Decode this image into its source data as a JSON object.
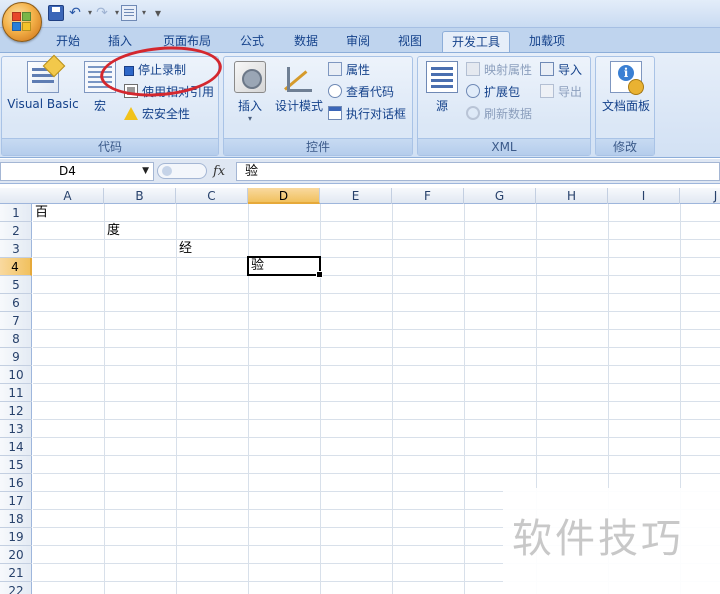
{
  "qat": {
    "save_icon": "save-icon",
    "undo_icon": "undo-icon",
    "redo_icon": "redo-icon",
    "customize": "▾"
  },
  "tabs": [
    {
      "label": "开始"
    },
    {
      "label": "插入"
    },
    {
      "label": "页面布局"
    },
    {
      "label": "公式"
    },
    {
      "label": "数据"
    },
    {
      "label": "审阅"
    },
    {
      "label": "视图"
    },
    {
      "label": "开发工具",
      "active": true
    },
    {
      "label": "加载项"
    }
  ],
  "ribbon": {
    "code": {
      "label": "代码",
      "visual_basic": "Visual Basic",
      "macros": "宏",
      "stop_recording": "停止录制",
      "relative_ref": "使用相对引用",
      "macro_security": "宏安全性"
    },
    "controls": {
      "label": "控件",
      "insert": "插入",
      "design_mode": "设计模式",
      "properties": "属性",
      "view_code": "查看代码",
      "run_dialog": "执行对话框"
    },
    "xml": {
      "label": "XML",
      "source": "源",
      "map_properties": "映射属性",
      "expansion_packs": "扩展包",
      "refresh_data": "刷新数据",
      "import": "导入",
      "export": "导出"
    },
    "modify": {
      "label": "修改",
      "document_panel": "文档面板"
    }
  },
  "formula_bar": {
    "name_box": "D4",
    "fx": "fx",
    "content": "验"
  },
  "columns": [
    "A",
    "B",
    "C",
    "D",
    "E",
    "F",
    "G",
    "H",
    "I",
    "J"
  ],
  "rows": [
    "1",
    "2",
    "3",
    "4",
    "5",
    "6",
    "7",
    "8",
    "9",
    "10",
    "11",
    "12",
    "13",
    "14",
    "15",
    "16",
    "17",
    "18",
    "19",
    "20",
    "21",
    "22"
  ],
  "cells": {
    "A1": "百",
    "B2": "度",
    "C3": "经",
    "D4": "验"
  },
  "selected": {
    "column": "D",
    "row": "4"
  },
  "annotation_color": "#d4272e",
  "watermark": "软件技巧"
}
